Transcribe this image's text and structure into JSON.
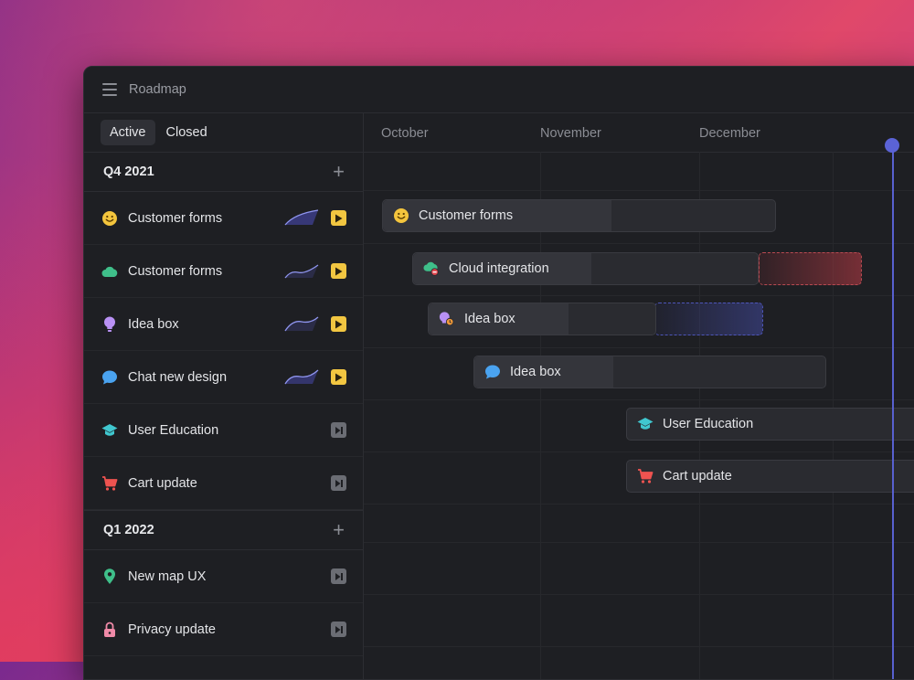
{
  "window": {
    "title": "Roadmap"
  },
  "tabs": [
    {
      "label": "Active"
    },
    {
      "label": "Closed"
    }
  ],
  "groups": [
    {
      "label": "Q4 2021"
    },
    {
      "label": "Q1 2022"
    }
  ],
  "rows": [
    {
      "label": "Customer forms",
      "icon": "smiley-icon",
      "action": "play-icon"
    },
    {
      "label": "Customer forms",
      "icon": "cloud-icon",
      "action": "play-icon"
    },
    {
      "label": "Idea box",
      "icon": "lightbulb-icon",
      "action": "play-icon"
    },
    {
      "label": "Chat new design",
      "icon": "chat-bubble-icon",
      "action": "play-icon"
    },
    {
      "label": "User Education",
      "icon": "graduation-cap-icon",
      "action": "skip-icon"
    },
    {
      "label": "Cart update",
      "icon": "cart-icon",
      "action": "skip-icon"
    },
    {
      "label": "New map UX",
      "icon": "map-pin-icon",
      "action": "skip-icon"
    },
    {
      "label": "Privacy update",
      "icon": "padlock-icon",
      "action": "skip-icon"
    }
  ],
  "timeline": {
    "months": [
      "October",
      "November",
      "December"
    ],
    "bars": [
      {
        "label": "Customer forms",
        "icon": "smiley-icon"
      },
      {
        "label": "Cloud integration",
        "icon": "cloud-remove-icon"
      },
      {
        "label": "Idea box",
        "icon": "lightbulb-clock-icon"
      },
      {
        "label": "Idea box",
        "icon": "chat-bubble-icon"
      },
      {
        "label": "User Education",
        "icon": "graduation-cap-icon"
      },
      {
        "label": "Cart update",
        "icon": "cart-icon"
      }
    ]
  },
  "colors": {
    "accent": "#5b63d6",
    "play": "#f2c641",
    "skip": "#6b6d74",
    "overdue": "#b94a52"
  }
}
